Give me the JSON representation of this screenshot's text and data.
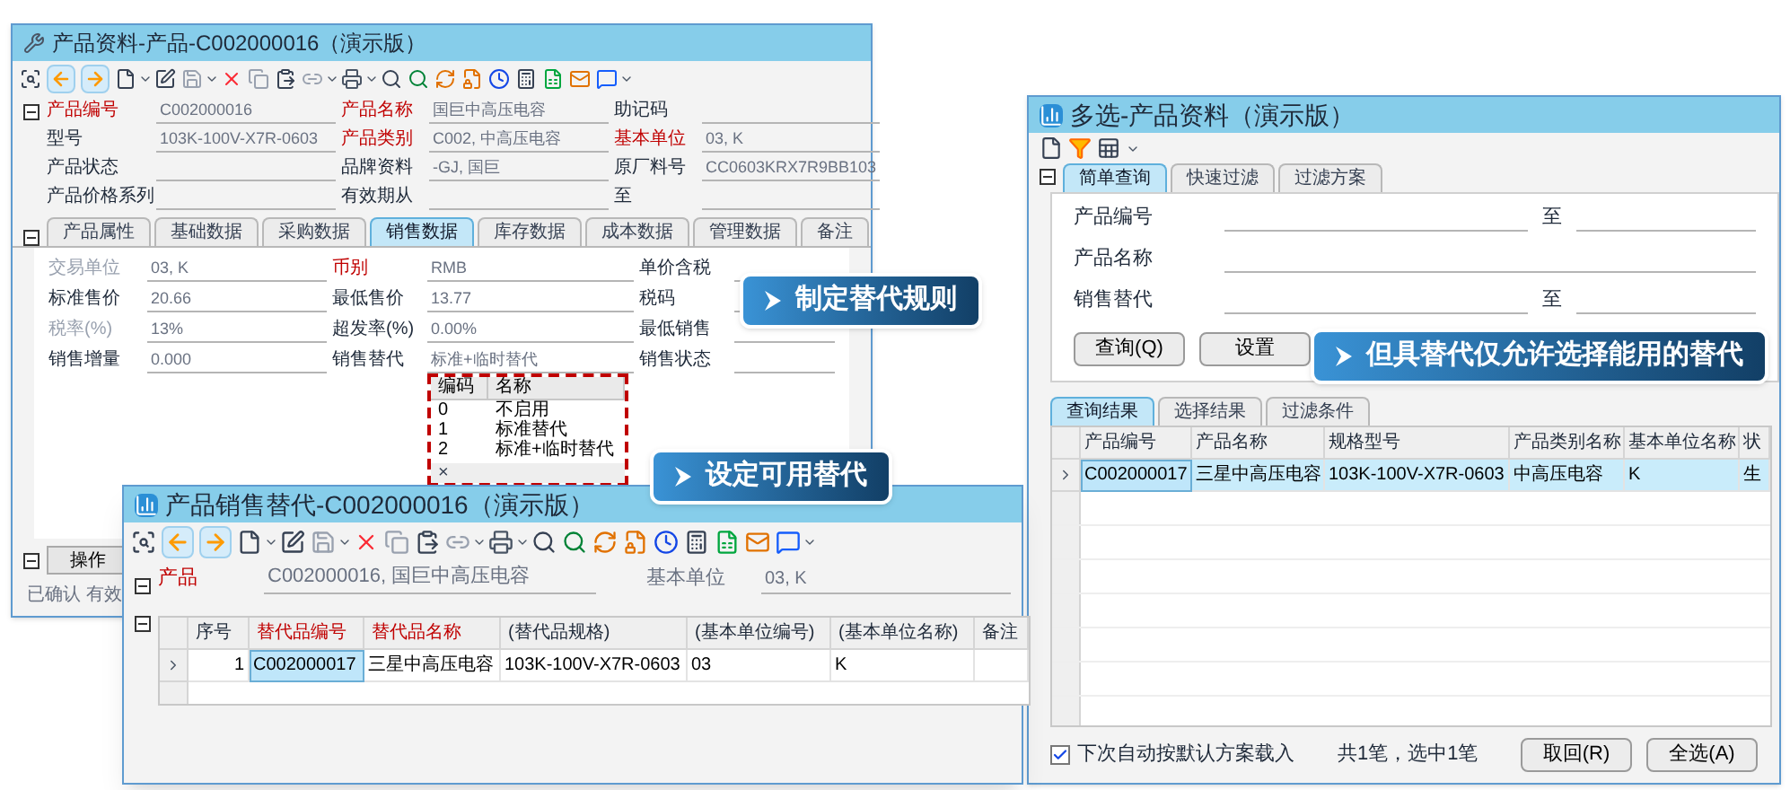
{
  "product_window": {
    "title": "产品资料-产品-C002000016（演示版）",
    "header_rows": [
      [
        {
          "label": "产品编号",
          "kind": "required",
          "value": "C002000016"
        },
        {
          "label": "产品名称",
          "kind": "required",
          "value": "国巨中高压电容"
        },
        {
          "label": "助记码",
          "kind": "normal"
        }
      ],
      [
        {
          "label": "型号",
          "kind": "normal",
          "value": "103K-100V-X7R-0603"
        },
        {
          "label": "产品类别",
          "kind": "required",
          "value": "C002, 中高压电容"
        },
        {
          "label": "基本单位",
          "kind": "required",
          "value": "03, K"
        }
      ],
      [
        {
          "label": "产品状态",
          "kind": "normal"
        },
        {
          "label": "品牌资料",
          "kind": "normal",
          "value": "-GJ, 国巨"
        },
        {
          "label": "原厂料号",
          "kind": "normal",
          "value": "CC0603KRX7R9BB103"
        }
      ],
      [
        {
          "label": "产品价格系列",
          "kind": "normal"
        },
        {
          "label": "有效期从",
          "kind": "normal"
        },
        {
          "label": "至",
          "kind": "normal"
        }
      ]
    ],
    "tabs": [
      {
        "label": "产品属性",
        "selected": false
      },
      {
        "label": "基础数据",
        "selected": false
      },
      {
        "label": "采购数据",
        "selected": false
      },
      {
        "label": "销售数据",
        "selected": true
      },
      {
        "label": "库存数据",
        "selected": false
      },
      {
        "label": "成本数据",
        "selected": false
      },
      {
        "label": "管理数据",
        "selected": false
      },
      {
        "label": "备注",
        "selected": false
      }
    ],
    "sales_rows": [
      [
        {
          "label": "交易单位",
          "kind": "muted",
          "value": "03, K"
        },
        {
          "label": "币别",
          "kind": "required",
          "value": "RMB"
        },
        {
          "label": "单价含税",
          "kind": "normal"
        }
      ],
      [
        {
          "label": "标准售价",
          "kind": "normal",
          "value": "20.66"
        },
        {
          "label": "最低售价",
          "kind": "normal",
          "value": "13.77"
        },
        {
          "label": "税码",
          "kind": "normal"
        }
      ],
      [
        {
          "label": "税率(%)",
          "kind": "muted",
          "value": "13%"
        },
        {
          "label": "超发率(%)",
          "kind": "normal",
          "value": "0.00%"
        },
        {
          "label": "最低销售",
          "kind": "normal"
        }
      ],
      [
        {
          "label": "销售增量",
          "kind": "normal",
          "value": "0.000"
        },
        {
          "label": "销售替代",
          "kind": "normal",
          "value": "标准+临时替代"
        },
        {
          "label": "销售状态",
          "kind": "normal"
        }
      ]
    ],
    "substitution_options": {
      "columns": [
        "编码",
        "名称"
      ],
      "rows": [
        {
          "code": "0",
          "name": "不启用"
        },
        {
          "code": "1",
          "name": "标准替代"
        },
        {
          "code": "2",
          "name": "标准+临时替代"
        }
      ],
      "close": "×"
    },
    "operate_button": "操作",
    "status_text": "已确认 有效"
  },
  "substitute_window": {
    "title": "产品销售替代-C002000016（演示版）",
    "product_label": "产品",
    "product_value": "C002000016, 国巨中高压电容",
    "unit_label": "基本单位",
    "unit_value": "03, K",
    "columns": [
      {
        "label": "序号",
        "required": false
      },
      {
        "label": "替代品编号",
        "required": true
      },
      {
        "label": "替代品名称",
        "required": true
      },
      {
        "label": "(替代品规格)",
        "required": false
      },
      {
        "label": "(基本单位编号)",
        "required": false
      },
      {
        "label": "(基本单位名称)",
        "required": false
      },
      {
        "label": "备注",
        "required": false
      }
    ],
    "rows": [
      {
        "selected": true,
        "cells": [
          {
            "text": "1",
            "focused": false
          },
          {
            "text": "C002000017",
            "focused": true
          },
          {
            "text": "三星中高压电容",
            "focused": false
          },
          {
            "text": "103K-100V-X7R-0603",
            "focused": false
          },
          {
            "text": "03",
            "focused": false
          },
          {
            "text": "K",
            "focused": false
          },
          {
            "text": "",
            "focused": false
          }
        ]
      }
    ]
  },
  "picker_window": {
    "title": "多选-产品资料（演示版）",
    "query_tabs": [
      {
        "label": "简单查询",
        "selected": true
      },
      {
        "label": "快速过滤",
        "selected": false
      },
      {
        "label": "过滤方案",
        "selected": false
      }
    ],
    "query_fields": [
      {
        "label": "产品编号",
        "to_label": "至"
      },
      {
        "label": "产品名称"
      },
      {
        "label": "销售替代",
        "to_label": "至"
      }
    ],
    "query_buttons": [
      "查询(Q)",
      "设置"
    ],
    "result_tabs": [
      {
        "label": "查询结果",
        "selected": true
      },
      {
        "label": "选择结果",
        "selected": false
      },
      {
        "label": "过滤条件",
        "selected": false
      }
    ],
    "columns": [
      "产品编号",
      "产品名称",
      "规格型号",
      "产品类别名称",
      "基本单位名称",
      "状"
    ],
    "rows": [
      {
        "selected": true,
        "cells": [
          {
            "text": "C002000017",
            "focused": true
          },
          {
            "text": "三星中高压电容",
            "focused": false
          },
          {
            "text": "103K-100V-X7R-0603",
            "focused": false
          },
          {
            "text": "中高压电容",
            "focused": false
          },
          {
            "text": "K",
            "focused": false
          },
          {
            "text": "生",
            "focused": false
          }
        ]
      }
    ],
    "auto_load": {
      "label": "下次自动按默认方案载入",
      "checked": true
    },
    "summary": "共1笔，选中1笔",
    "buttons": [
      "取回(R)",
      "全选(A)"
    ]
  },
  "callouts": [
    {
      "text": "制定替代规则"
    },
    {
      "text": "设定可用替代"
    },
    {
      "text": "但具替代仅允许选择能用的替代"
    }
  ]
}
